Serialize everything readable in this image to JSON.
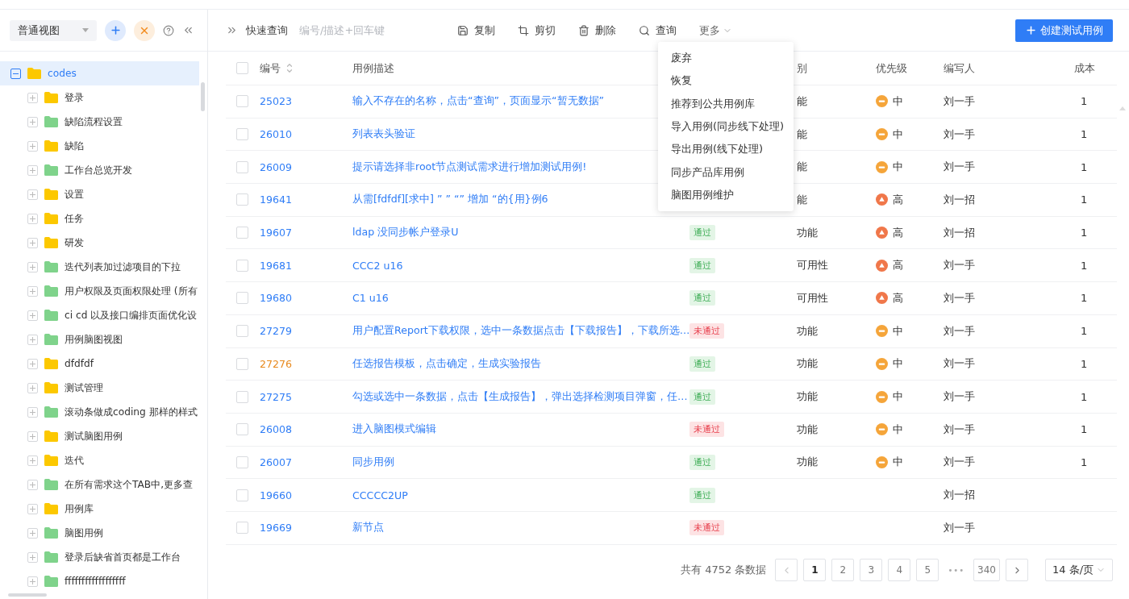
{
  "sidebar": {
    "view_select": "普通视图",
    "tree": [
      {
        "label": "codes",
        "color": "#fcc800",
        "selected": true,
        "expanded": true,
        "children": [
          {
            "label": "登录",
            "color": "#fcc800",
            "selected": false,
            "expanded": false
          },
          {
            "label": "缺陷流程设置",
            "color": "#7fd38b",
            "selected": false,
            "expanded": false
          },
          {
            "label": "缺陷",
            "color": "#fcc800",
            "selected": false,
            "expanded": false
          },
          {
            "label": "工作台总览开发",
            "color": "#7fd38b",
            "selected": false,
            "expanded": false
          },
          {
            "label": "设置",
            "color": "#fcc800",
            "selected": false,
            "expanded": false
          },
          {
            "label": "任务",
            "color": "#fcc800",
            "selected": false,
            "expanded": false
          },
          {
            "label": "研发",
            "color": "#fcc800",
            "selected": false,
            "expanded": false
          },
          {
            "label": "迭代列表加过滤项目的下拉",
            "color": "#7fd38b",
            "selected": false,
            "expanded": false
          },
          {
            "label": "用户权限及页面权限处理 (所有",
            "color": "#7fd38b",
            "selected": false,
            "expanded": false
          },
          {
            "label": "ci cd 以及接口编排页面优化设",
            "color": "#7fd38b",
            "selected": false,
            "expanded": false
          },
          {
            "label": "用例脑图视图",
            "color": "#7fd38b",
            "selected": false,
            "expanded": false
          },
          {
            "label": "dfdfdf",
            "color": "#fcc800",
            "selected": false,
            "expanded": false
          },
          {
            "label": "测试管理",
            "color": "#fcc800",
            "selected": false,
            "expanded": false
          },
          {
            "label": "滚动条做成coding 那样的样式",
            "color": "#7fd38b",
            "selected": false,
            "expanded": false
          },
          {
            "label": "测试脑图用例",
            "color": "#fcc800",
            "selected": false,
            "expanded": false
          },
          {
            "label": "迭代",
            "color": "#fcc800",
            "selected": false,
            "expanded": false
          },
          {
            "label": "在所有需求这个TAB中,更多查",
            "color": "#7fd38b",
            "selected": false,
            "expanded": false
          },
          {
            "label": "用例库",
            "color": "#fcc800",
            "selected": false,
            "expanded": false
          },
          {
            "label": "脑图用例",
            "color": "#7fd38b",
            "selected": false,
            "expanded": false
          },
          {
            "label": "登录后缺省首页都是工作台",
            "color": "#7fd38b",
            "selected": false,
            "expanded": false
          },
          {
            "label": "ffffffffffffffffff",
            "color": "#7fd38b",
            "selected": false,
            "expanded": false
          }
        ]
      }
    ]
  },
  "toolbar": {
    "quick_search_label": "快速查询",
    "search_placeholder": "编号/描述+回车键",
    "actions": [
      {
        "kind": "copy",
        "label": "复制"
      },
      {
        "kind": "cut",
        "label": "剪切"
      },
      {
        "kind": "delete",
        "label": "删除"
      },
      {
        "kind": "search",
        "label": "查询"
      }
    ],
    "more_label": "更多",
    "create_button": "创建测试用例"
  },
  "more_menu": [
    "废弃",
    "恢复",
    "推荐到公共用例库",
    "导入用例(同步线下处理)",
    "导出用例(线下处理)",
    "同步产品库用例",
    "脑图用例维护"
  ],
  "table": {
    "header_checked": false,
    "columns": {
      "id": "编号",
      "description": "用例描述",
      "type": "别",
      "priority": "优先级",
      "author": "编写人",
      "cost": "成本"
    },
    "rows": [
      {
        "checked": false,
        "id": "25023",
        "flagged": false,
        "description": "输入不存在的名称，点击“查询”，页面显示“暂无数据”",
        "type": "能",
        "priority": {
          "kind": "medium",
          "label": "中"
        },
        "author": "刘一手",
        "cost": "1"
      },
      {
        "checked": false,
        "id": "26010",
        "flagged": false,
        "description": "列表表头验证",
        "type": "能",
        "priority": {
          "kind": "medium",
          "label": "中"
        },
        "author": "刘一手",
        "cost": "1"
      },
      {
        "checked": false,
        "id": "26009",
        "flagged": false,
        "description": "提示请选择非root节点测试需求进行增加测试用例!",
        "type": "能",
        "priority": {
          "kind": "medium",
          "label": "中"
        },
        "author": "刘一手",
        "cost": "1"
      },
      {
        "checked": false,
        "id": "19641",
        "flagged": false,
        "description": "从需[fdfdf][求中] ” ” “” 增加 “的{用}例6",
        "type": "能",
        "priority": {
          "kind": "high",
          "label": "高"
        },
        "author": "刘一招",
        "cost": "1"
      },
      {
        "checked": false,
        "id": "19607",
        "flagged": false,
        "description": "ldap 没同步帐户登录U",
        "status": {
          "kind": "pass",
          "label": "通过"
        },
        "type": "功能",
        "priority": {
          "kind": "high",
          "label": "高"
        },
        "author": "刘一招",
        "cost": "1"
      },
      {
        "checked": false,
        "id": "19681",
        "flagged": false,
        "description": "CCC2 u16",
        "status": {
          "kind": "pass",
          "label": "通过"
        },
        "type": "可用性",
        "priority": {
          "kind": "high",
          "label": "高"
        },
        "author": "刘一手",
        "cost": "1"
      },
      {
        "checked": false,
        "id": "19680",
        "flagged": false,
        "description": "C1 u16",
        "status": {
          "kind": "pass",
          "label": "通过"
        },
        "type": "可用性",
        "priority": {
          "kind": "high",
          "label": "高"
        },
        "author": "刘一手",
        "cost": "1"
      },
      {
        "checked": false,
        "id": "27279",
        "flagged": false,
        "description": "用户配置Report下载权限，选中一条数据点击【下载报告】，下载所选…",
        "status": {
          "kind": "fail",
          "label": "未通过"
        },
        "type": "功能",
        "priority": {
          "kind": "medium",
          "label": "中"
        },
        "author": "刘一手",
        "cost": "1"
      },
      {
        "checked": false,
        "id": "27276",
        "flagged": true,
        "description": "任选报告模板，点击确定，生成实验报告",
        "status": {
          "kind": "pass",
          "label": "通过"
        },
        "type": "功能",
        "priority": {
          "kind": "medium",
          "label": "中"
        },
        "author": "刘一手",
        "cost": "1"
      },
      {
        "checked": false,
        "id": "27275",
        "flagged": false,
        "description": "勾选或选中一条数据，点击【生成报告】，弹出选择检测项目弹窗，任…",
        "status": {
          "kind": "pass",
          "label": "通过"
        },
        "type": "功能",
        "priority": {
          "kind": "medium",
          "label": "中"
        },
        "author": "刘一手",
        "cost": "1"
      },
      {
        "checked": false,
        "id": "26008",
        "flagged": false,
        "description": "进入脑图模式编辑",
        "status": {
          "kind": "fail",
          "label": "未通过"
        },
        "type": "功能",
        "priority": {
          "kind": "medium",
          "label": "中"
        },
        "author": "刘一手",
        "cost": "1"
      },
      {
        "checked": false,
        "id": "26007",
        "flagged": false,
        "description": "同步用例",
        "status": {
          "kind": "pass",
          "label": "通过"
        },
        "type": "功能",
        "priority": {
          "kind": "medium",
          "label": "中"
        },
        "author": "刘一手",
        "cost": "1"
      },
      {
        "checked": false,
        "id": "19660",
        "flagged": false,
        "description": "CCCCC2UP",
        "status": {
          "kind": "pass",
          "label": "通过"
        },
        "author": "刘一招"
      },
      {
        "checked": false,
        "id": "19669",
        "flagged": false,
        "description": "新节点",
        "status": {
          "kind": "fail",
          "label": "未通过"
        },
        "author": "刘一手"
      }
    ]
  },
  "pagination": {
    "total": "共有 4752 条数据",
    "pages": [
      {
        "label": "1",
        "selected": true
      },
      {
        "label": "2",
        "selected": false
      },
      {
        "label": "3",
        "selected": false
      },
      {
        "label": "4",
        "selected": false
      },
      {
        "label": "5",
        "selected": false
      }
    ],
    "ellipsis": "•••",
    "last_page": "340",
    "page_size": "14 条/页"
  }
}
